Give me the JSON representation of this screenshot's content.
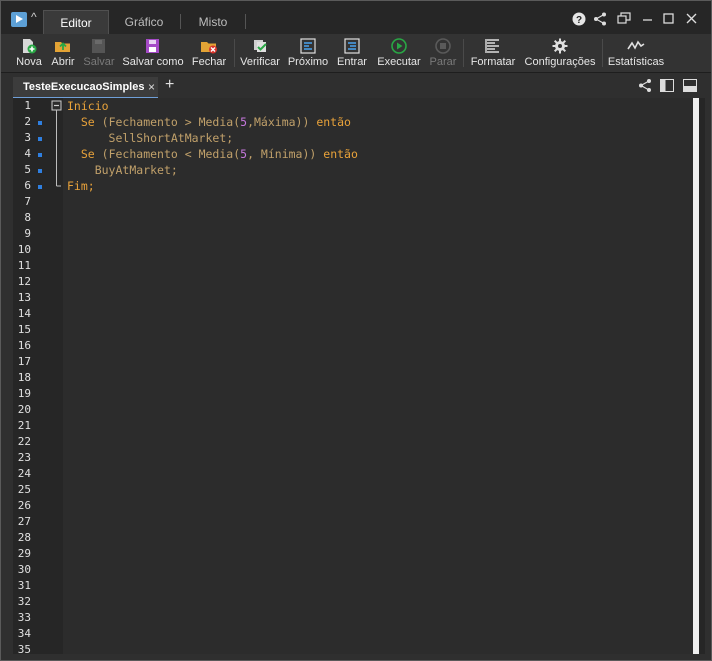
{
  "titlebar": {
    "tabs": [
      {
        "label": "Editor",
        "active": true
      },
      {
        "label": "Gráfico",
        "active": false
      },
      {
        "label": "Misto",
        "active": false
      }
    ],
    "window_icons": {
      "help": "question-icon",
      "share": "share-icon",
      "restore": "restore-icon",
      "minimize": "minimize-icon",
      "maximize": "maximize-icon",
      "close": "close-icon"
    }
  },
  "toolbar": {
    "nova": "Nova",
    "abrir": "Abrir",
    "salvar": "Salvar",
    "salvar_como": "Salvar como",
    "fechar": "Fechar",
    "verificar": "Verificar",
    "proximo": "Próximo",
    "entrar": "Entrar",
    "executar": "Executar",
    "parar": "Parar",
    "formatar": "Formatar",
    "configuracoes": "Configurações",
    "estatisticas": "Estatísticas"
  },
  "document": {
    "tab_name": "TesteExecucaoSimples",
    "close_glyph": "×",
    "add_glyph": "+"
  },
  "editor": {
    "line_numbers": [
      "1",
      "2",
      "3",
      "4",
      "5",
      "6",
      "7",
      "8",
      "9",
      "10",
      "11",
      "12",
      "13",
      "14",
      "15",
      "16",
      "17",
      "18",
      "19",
      "20",
      "21",
      "22",
      "23",
      "24",
      "25",
      "26",
      "27",
      "28",
      "29",
      "30",
      "31",
      "32",
      "33",
      "34",
      "35"
    ],
    "code": {
      "l1_kw": "Início",
      "l2_a": "Se",
      "l2_b": "(Fechamento > Media(",
      "l2_n": "5",
      "l2_c": ",Máxima))",
      "l2_d": "então",
      "l3": "SellShortAtMarket;",
      "l4_a": "Se",
      "l4_b": "(Fechamento < Media(",
      "l4_n": "5",
      "l4_c": ", Mínima))",
      "l4_d": "então",
      "l5": "BuyAtMarket;",
      "l6": "Fim;"
    },
    "colors": {
      "keyword": "#e8a23a",
      "number": "#c678dd",
      "marker": "#2f7fe0"
    }
  }
}
